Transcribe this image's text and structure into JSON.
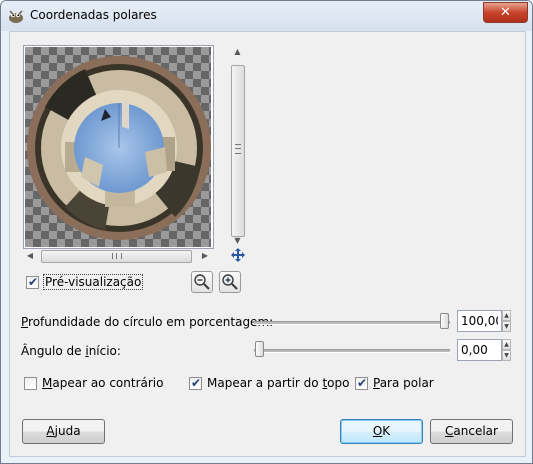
{
  "window": {
    "title": "Coordenadas polares",
    "close_glyph": "✕",
    "app_icon": "gimp-wilber-icon"
  },
  "preview": {
    "checkbox_checked": true,
    "label": "Pré-visualização",
    "zoom_out_icon": "zoom-out-icon",
    "zoom_in_icon": "zoom-in-icon",
    "navigate_icon": "move-arrows-icon"
  },
  "depth": {
    "label_underlined": "P",
    "label_rest": "rofundidade do círculo em porcentagem:",
    "value": "100,00",
    "level_percent": 100
  },
  "angle": {
    "label_start": "Ângulo de ",
    "label_underlined": "i",
    "label_rest": "nício:",
    "value": "0,00",
    "level_percent": 0
  },
  "options": {
    "reverse": {
      "label_underlined": "M",
      "label_rest": "apear ao contrário",
      "checked": false
    },
    "from_top": {
      "label_start": "Mapear a partir do ",
      "label_underlined": "t",
      "label_rest": "opo",
      "checked": true
    },
    "to_polar": {
      "label_start": "",
      "label_underlined": "P",
      "label_rest": "ara polar",
      "checked": true
    }
  },
  "buttons": {
    "help_underlined": "A",
    "help_rest": "juda",
    "ok_underlined": "O",
    "ok_rest": "K",
    "cancel_underlined": "C",
    "cancel_rest": "ancelar"
  },
  "colors": {
    "sky": "#7ea6d8",
    "building": "#d8cdb8",
    "shadow": "#2a2a22",
    "ground": "#8a6e5a"
  }
}
